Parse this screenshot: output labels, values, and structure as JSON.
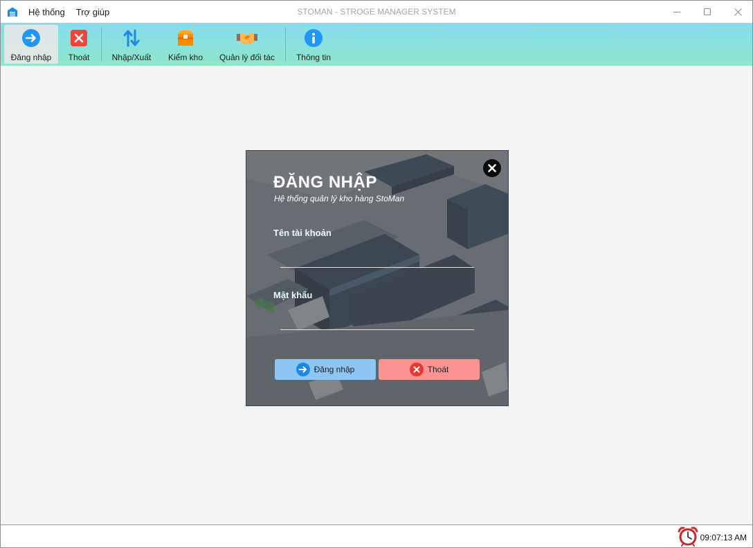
{
  "window": {
    "title": "STOMAN - STROGE MANAGER SYSTEM",
    "menu": [
      "Hệ thống",
      "Trợ giúp"
    ]
  },
  "toolbar": {
    "items": [
      {
        "label": "Đăng nhập",
        "icon": "login-arrow-icon",
        "active": true
      },
      {
        "label": "Thoát",
        "icon": "exit-x-icon"
      },
      {
        "label": "Nhập/Xuất",
        "icon": "import-export-arrows-icon"
      },
      {
        "label": "Kiểm kho",
        "icon": "box-icon"
      },
      {
        "label": "Quản lý đối tác",
        "icon": "handshake-icon"
      },
      {
        "label": "Thông tin",
        "icon": "info-icon"
      }
    ]
  },
  "login_dialog": {
    "title": "ĐĂNG NHẬP",
    "subtitle": "Hệ thống quản lý kho hàng StoMan",
    "username_label": "Tên tài khoản",
    "username_value": "",
    "password_label": "Mật khẩu",
    "password_value": "",
    "login_button": "Đăng nhập",
    "exit_button": "Thoát"
  },
  "statusbar": {
    "time": "09:07:13 AM"
  },
  "colors": {
    "toolbar_top": "#86dcef",
    "toolbar_bottom": "#8ee6cb",
    "login_button": "#8dc6f4",
    "exit_button": "#fb9393",
    "accent_blue": "#2196f3",
    "accent_red": "#e53935"
  }
}
